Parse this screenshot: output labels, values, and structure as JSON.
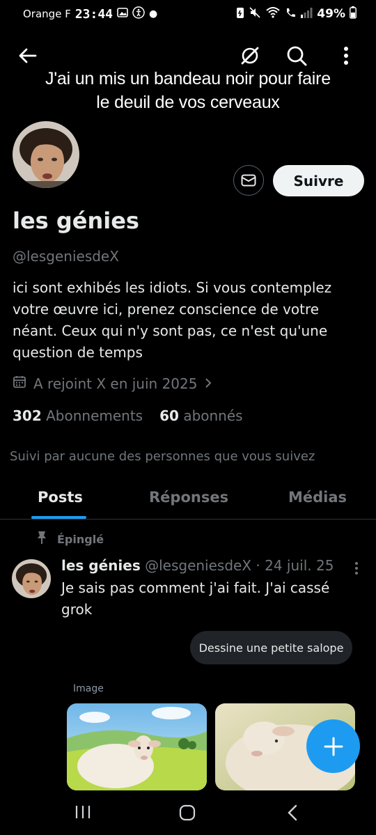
{
  "status": {
    "carrier": "Orange F",
    "time": "23:44",
    "battery": "49%"
  },
  "banner": {
    "line1": "J'ai un mis un bandeau noir pour faire",
    "line2": "le deuil de vos cerveaux"
  },
  "profile": {
    "follow_label": "Suivre",
    "name": "les génies",
    "handle": "@lesgeniesdeX",
    "bio": "ici sont exhibés les idiots. Si vous contemplez votre œuvre ici, prenez conscience de votre néant. Ceux qui n'y sont pas, ce n'est qu'une question de temps",
    "joined": "A rejoint X en juin 2025",
    "following_count": "302",
    "following_label": "Abonnements",
    "followers_count": "60",
    "followers_label": "abonnés",
    "followed_by": "Suivi par aucune des personnes que vous suivez"
  },
  "tabs": [
    {
      "label": "Posts"
    },
    {
      "label": "Réponses"
    },
    {
      "label": "Médias"
    }
  ],
  "post": {
    "pinned_label": "Épinglé",
    "author": "les génies",
    "meta": "@lesgeniesdeX · 24 juil. 25",
    "text": "Je sais pas comment j'ai fait. J'ai cassé grok",
    "tooltip": "Dessine une petite salope",
    "image_label": "Image"
  },
  "colors": {
    "accent": "#1d9bf0",
    "background": "#000000",
    "muted": "#71767b"
  }
}
